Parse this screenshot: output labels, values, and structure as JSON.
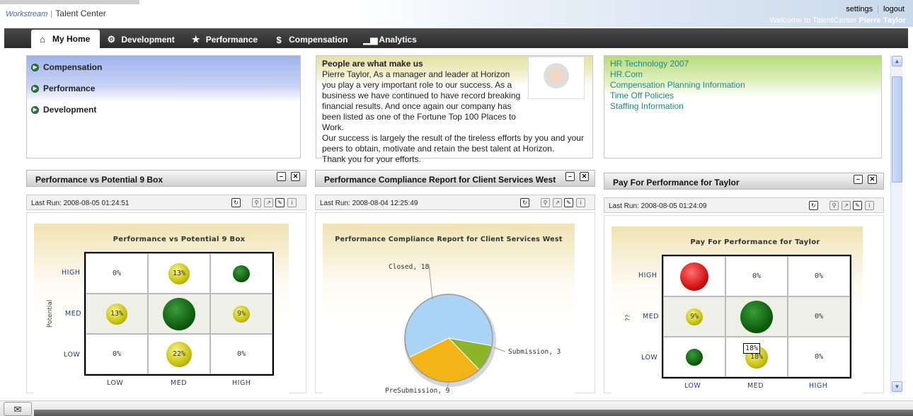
{
  "header": {
    "logo_brand": "Workstream",
    "logo_app": "Talent Center",
    "settings_link": "settings",
    "logout_link": "logout",
    "welcome_prefix": "Welcome to TalentCenter",
    "welcome_user": "Pierre Taylor"
  },
  "nav": {
    "tabs": [
      {
        "label": "My Home",
        "icon": "home-icon"
      },
      {
        "label": "Development",
        "icon": "gear-icon"
      },
      {
        "label": "Performance",
        "icon": "star-icon"
      },
      {
        "label": "Compensation",
        "icon": "dollar-icon"
      },
      {
        "label": "Analytics",
        "icon": "bar-chart-icon"
      }
    ]
  },
  "quick_links": {
    "items": [
      "Compensation",
      "Performance",
      "Development"
    ]
  },
  "message": {
    "heading": "People are what make us",
    "paragraph1": "Pierre Taylor, As a manager and leader at Horizon you play a very important role to our success. As a business we have continued to have record breaking financial results. And once again our company has been listed as one of the Fortune Top 100 Places to Work.",
    "paragraph2": "Our success is largely the result of the tireless efforts by you and your peers to obtain, motivate and retain the best talent at Horizon.",
    "paragraph3": "Thank you for your efforts."
  },
  "hr_links": {
    "items": [
      "HR Technology 2007",
      "HR.Com",
      "Compensation Planning Information",
      "Time Off Policies",
      "Staffing Information"
    ]
  },
  "widgets": [
    {
      "title": "Performance vs Potential 9 Box",
      "last_run": "Last Run: 2008-08-05 01:24:51"
    },
    {
      "title": "Performance Compliance Report for Client Services West",
      "last_run": "Last Run: 2008-08-04 12:25:49"
    },
    {
      "title": "Pay For Performance for Taylor",
      "last_run": "Last Run: 2008-08-05 01:24:09"
    }
  ],
  "chart_data": [
    {
      "type": "heatmap",
      "title": "Performance vs Potential 9 Box",
      "ylabel": "Potential",
      "xlabel": "",
      "columns": [
        "LOW",
        "MED",
        "HIGH"
      ],
      "rows": [
        "HIGH",
        "MED",
        "LOW"
      ],
      "cells": [
        [
          "0%",
          "13%",
          ""
        ],
        [
          "13%",
          "",
          "9%"
        ],
        [
          "0%",
          "22%",
          "0%"
        ]
      ],
      "bubbles": [
        [
          "none",
          "yellow",
          "green"
        ],
        [
          "yellow",
          "green",
          "yellow"
        ],
        [
          "none",
          "yellow",
          "none"
        ]
      ]
    },
    {
      "type": "pie",
      "title": "Performance Compliance Report for Client Services West",
      "slices": [
        {
          "label": "Closed",
          "value": 18,
          "color": "#a9d4f5"
        },
        {
          "label": "PreSubmission",
          "value": 9,
          "color": "#f2b416"
        },
        {
          "label": "Submission",
          "value": 3,
          "color": "#8cb52a"
        }
      ]
    },
    {
      "type": "heatmap",
      "title": "Pay For Performance for Taylor",
      "ylabel": "??",
      "xlabel": "",
      "columns": [
        "LOW",
        "MED",
        "HIGH"
      ],
      "rows": [
        "HIGH",
        "MED",
        "LOW"
      ],
      "cells": [
        [
          "",
          "0%",
          "0%"
        ],
        [
          "9%",
          "",
          "0%"
        ],
        [
          "",
          "18%",
          "0%"
        ]
      ],
      "bubbles": [
        [
          "red",
          "none",
          "none"
        ],
        [
          "yellow",
          "green",
          "none"
        ],
        [
          "green",
          "yellow",
          "none"
        ]
      ],
      "tooltip": "18%"
    }
  ]
}
